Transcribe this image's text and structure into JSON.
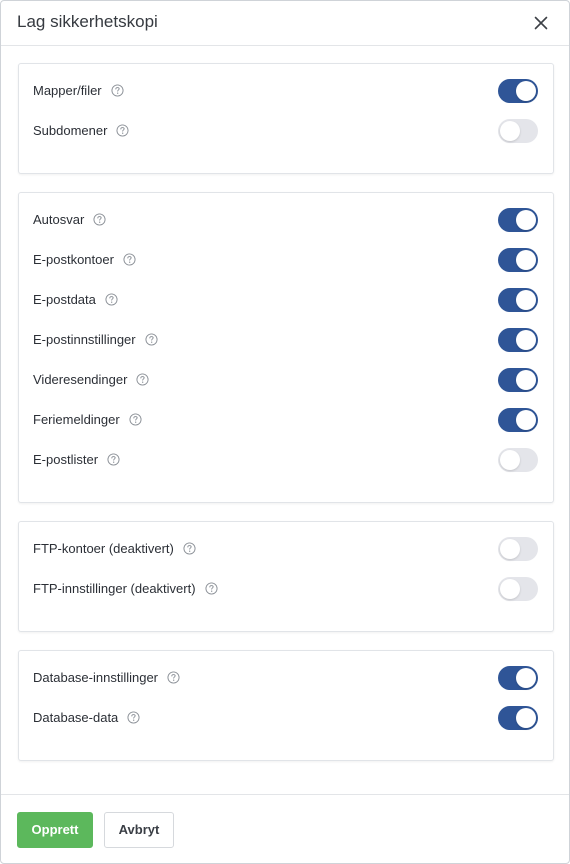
{
  "dialog": {
    "title": "Lag sikkerhetskopi",
    "close_icon": "close-icon"
  },
  "colors": {
    "toggle_on": "#2f5597",
    "toggle_off": "#e4e5ea",
    "primary_button": "#5cb85c"
  },
  "groups": [
    {
      "items": [
        {
          "label": "Mapper/filer",
          "enabled": true
        },
        {
          "label": "Subdomener",
          "enabled": false
        }
      ]
    },
    {
      "items": [
        {
          "label": "Autosvar",
          "enabled": true
        },
        {
          "label": "E-postkontoer",
          "enabled": true
        },
        {
          "label": "E-postdata",
          "enabled": true
        },
        {
          "label": "E-postinnstillinger",
          "enabled": true
        },
        {
          "label": "Videresendinger",
          "enabled": true
        },
        {
          "label": "Feriemeldinger",
          "enabled": true
        },
        {
          "label": "E-postlister",
          "enabled": false
        }
      ]
    },
    {
      "items": [
        {
          "label": "FTP-kontoer (deaktivert)",
          "enabled": false
        },
        {
          "label": "FTP-innstillinger (deaktivert)",
          "enabled": false
        }
      ]
    },
    {
      "items": [
        {
          "label": "Database-innstillinger",
          "enabled": true
        },
        {
          "label": "Database-data",
          "enabled": true
        }
      ]
    }
  ],
  "footer": {
    "create_label": "Opprett",
    "cancel_label": "Avbryt"
  }
}
